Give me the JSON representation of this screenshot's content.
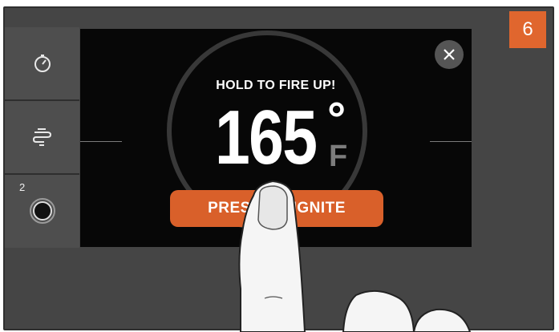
{
  "step_badge": "6",
  "sidebar": {
    "items": [
      {
        "icon": "timer-icon"
      },
      {
        "icon": "smoke-icon"
      },
      {
        "icon": "probe-icon",
        "label": "2"
      }
    ]
  },
  "dialog": {
    "heading": "HOLD TO FIRE UP!",
    "temperature": "165",
    "degree_symbol": "°",
    "unit": "F",
    "ignite_label": "PRESS TO IGNITE",
    "close_icon": "close-icon"
  },
  "colors": {
    "accent": "#d9602a",
    "badge": "#e0662e",
    "background": "#454545",
    "screen": "#070707"
  }
}
